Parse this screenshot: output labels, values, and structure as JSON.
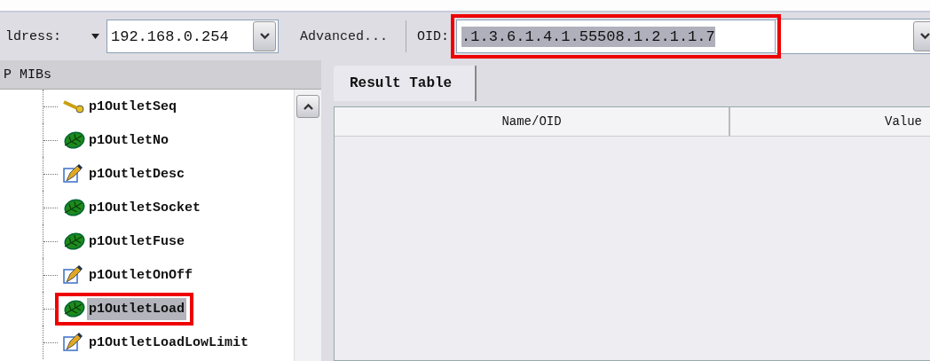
{
  "toolbar": {
    "address_label": "ldress:",
    "address_value": "192.168.0.254",
    "advanced_button": "Advanced...",
    "oid_label": "OID:",
    "oid_value": ".1.3.6.1.4.1.55508.1.2.1.1.7",
    "oid_highlighted": true
  },
  "mib_panel": {
    "title": "P MIBs",
    "items": [
      {
        "label": "p1OutletSeq",
        "kind": "key",
        "selected": false,
        "highlighted": false
      },
      {
        "label": "p1OutletNo",
        "kind": "leaf",
        "selected": false,
        "highlighted": false
      },
      {
        "label": "p1OutletDesc",
        "kind": "pen",
        "selected": false,
        "highlighted": false
      },
      {
        "label": "p1OutletSocket",
        "kind": "leaf",
        "selected": false,
        "highlighted": false
      },
      {
        "label": "p1OutletFuse",
        "kind": "leaf",
        "selected": false,
        "highlighted": false
      },
      {
        "label": "p1OutletOnOff",
        "kind": "pen",
        "selected": false,
        "highlighted": false
      },
      {
        "label": "p1OutletLoad",
        "kind": "leaf",
        "selected": true,
        "highlighted": true
      },
      {
        "label": "p1OutletLoadLowLimit",
        "kind": "pen",
        "selected": false,
        "highlighted": false
      }
    ]
  },
  "tabs": [
    {
      "label": "Result Table",
      "selected": true
    }
  ],
  "table": {
    "columns": [
      "Name/OID",
      "Value"
    ]
  }
}
